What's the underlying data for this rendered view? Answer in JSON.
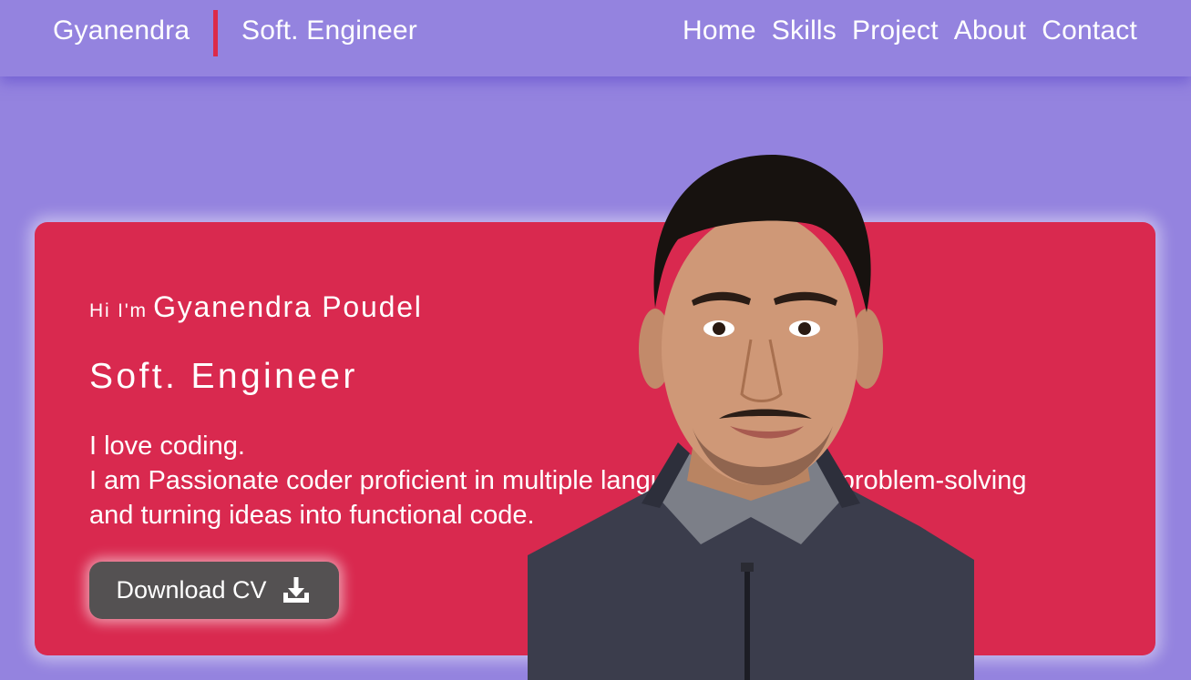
{
  "nav": {
    "brand_name": "Gyanendra",
    "brand_title": "Soft. Engineer",
    "links": [
      "Home",
      "Skills",
      "Project",
      "About",
      "Contact"
    ]
  },
  "hero": {
    "greeting_prefix": "Hi I'm",
    "name": "Gyanendra Poudel",
    "role": "Soft. Engineer",
    "bio_line1": "I love coding.",
    "bio_line2": "I am Passionate coder proficient in multiple languages, adept at problem-solving and turning ideas into functional code.",
    "download_label": "Download CV",
    "download_icon": "download-icon"
  },
  "colors": {
    "background": "#9483df",
    "card": "#d9294f",
    "accent_divider": "#dc2a4a",
    "button": "#545152"
  }
}
